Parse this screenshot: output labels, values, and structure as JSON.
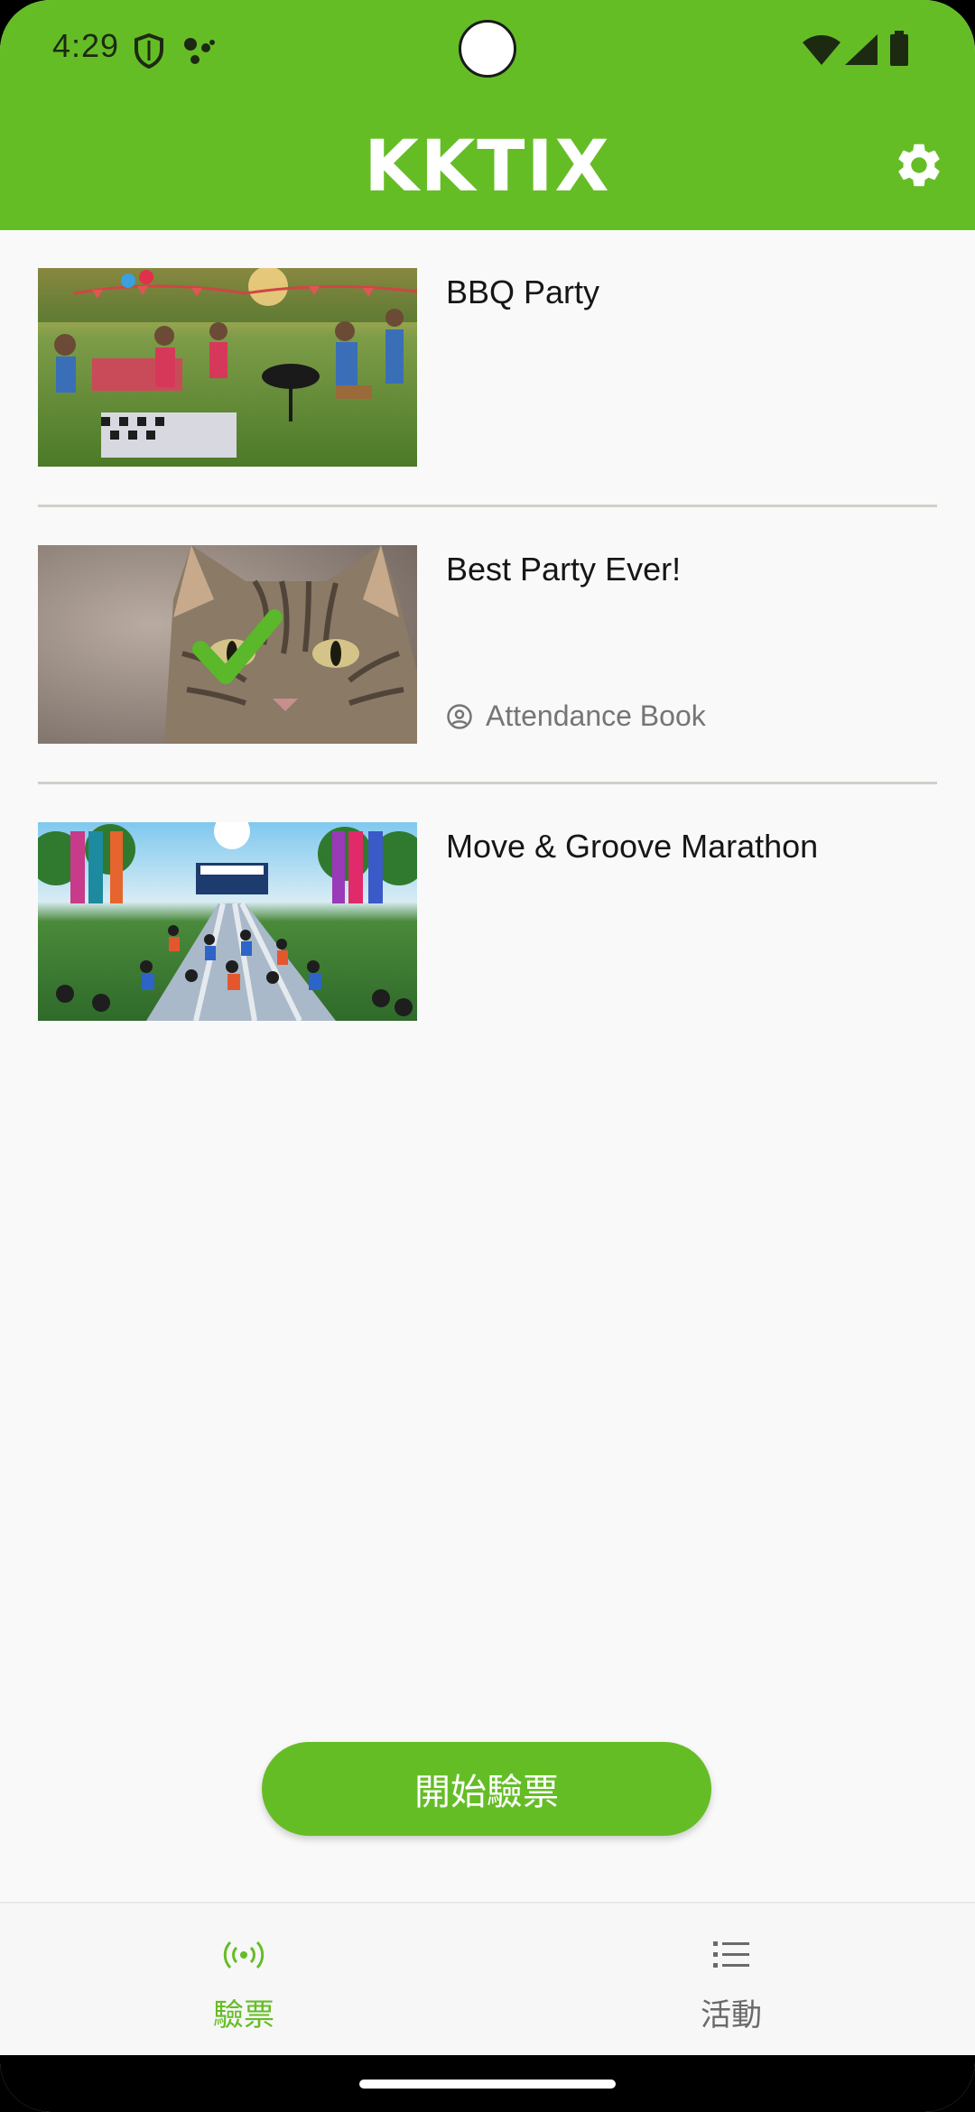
{
  "status_bar": {
    "time": "4:29",
    "icons": [
      "shield-icon",
      "assistant-dots-icon",
      "wifi-icon",
      "signal-icon",
      "battery-icon"
    ]
  },
  "app_bar": {
    "title": "KKTIX",
    "settings_icon": "gear-icon",
    "color": "#65bd26"
  },
  "events": [
    {
      "title": "BBQ Party",
      "thumbnail": "bbq-party-photo",
      "meta": ""
    },
    {
      "title": "Best Party Ever!",
      "thumbnail": "cat-photo-with-check",
      "meta": "Attendance Book",
      "meta_icon": "person-circle-icon"
    },
    {
      "title": "Move & Groove Marathon",
      "thumbnail": "marathon-illustration",
      "meta": ""
    }
  ],
  "start_button": {
    "label": "開始驗票"
  },
  "bottom_nav": {
    "items": [
      {
        "label": "驗票",
        "icon": "broadcast-icon",
        "active": true
      },
      {
        "label": "活動",
        "icon": "list-icon",
        "active": false
      }
    ]
  },
  "colors": {
    "accent": "#65bd26",
    "background": "#f9f9f9",
    "text_primary": "#161616",
    "text_secondary": "#757575"
  }
}
